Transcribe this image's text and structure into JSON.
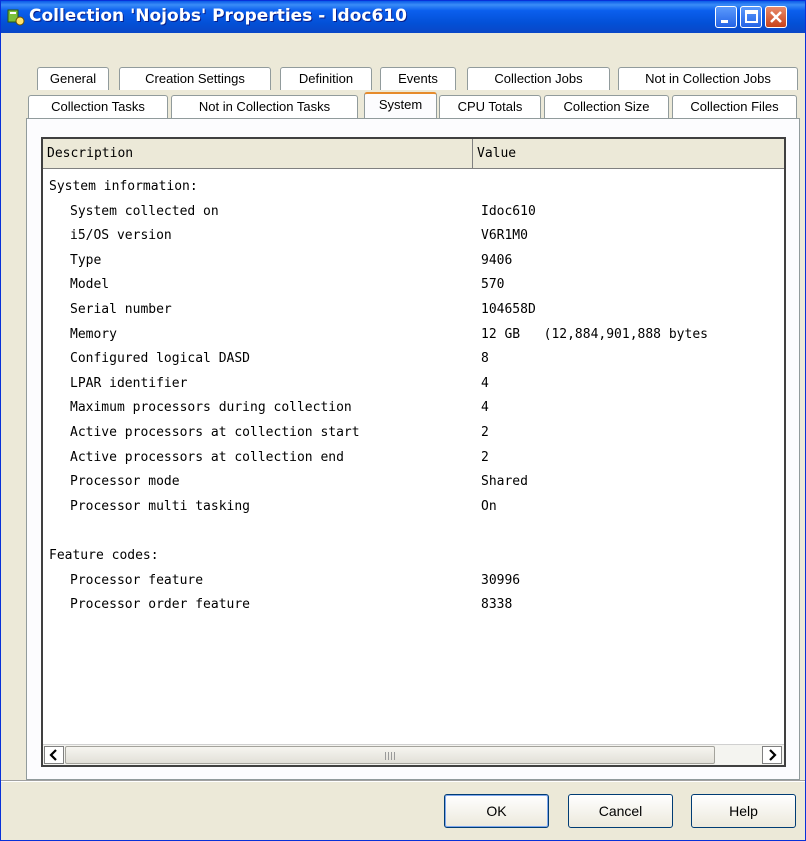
{
  "window": {
    "title": "Collection 'Nojobs' Properties - Idoc610",
    "icon": "collection-properties-icon"
  },
  "tabs_row1": [
    "General",
    "Creation Settings",
    "Definition",
    "Events",
    "Collection Jobs",
    "Not in Collection Jobs"
  ],
  "tabs_row2": [
    "Collection Tasks",
    "Not in Collection Tasks",
    "System",
    "CPU Totals",
    "Collection Size",
    "Collection Files"
  ],
  "active_tab": "System",
  "table": {
    "columns": [
      "Description",
      "Value"
    ],
    "rows": [
      {
        "description": "System information:",
        "value": "",
        "indent": false
      },
      {
        "description": "System collected on",
        "value": "Idoc610",
        "indent": true
      },
      {
        "description": "i5/OS version",
        "value": "V6R1M0",
        "indent": true
      },
      {
        "description": "Type",
        "value": "9406",
        "indent": true
      },
      {
        "description": "Model",
        "value": "570",
        "indent": true
      },
      {
        "description": "Serial number",
        "value": "104658D",
        "indent": true
      },
      {
        "description": "Memory",
        "value": "12 GB   (12,884,901,888 bytes",
        "indent": true
      },
      {
        "description": "Configured logical DASD",
        "value": "8",
        "indent": true
      },
      {
        "description": "LPAR identifier",
        "value": "4",
        "indent": true
      },
      {
        "description": "Maximum processors during collection",
        "value": "4",
        "indent": true
      },
      {
        "description": "Active processors at collection start",
        "value": "2",
        "indent": true
      },
      {
        "description": "Active processors at collection end",
        "value": "2",
        "indent": true
      },
      {
        "description": "Processor mode",
        "value": "Shared",
        "indent": true
      },
      {
        "description": "Processor multi tasking",
        "value": "On",
        "indent": true
      },
      {
        "description": "",
        "value": "",
        "indent": false
      },
      {
        "description": "Feature codes:",
        "value": "",
        "indent": false
      },
      {
        "description": "Processor feature",
        "value": "30996",
        "indent": true
      },
      {
        "description": "Processor order feature",
        "value": "8338",
        "indent": true
      }
    ]
  },
  "buttons": {
    "ok": "OK",
    "cancel": "Cancel",
    "help": "Help"
  },
  "colors": {
    "titlebar": "#0350d6",
    "window_bg": "#ece9d8",
    "active_tab_accent": "#e68b2c"
  }
}
